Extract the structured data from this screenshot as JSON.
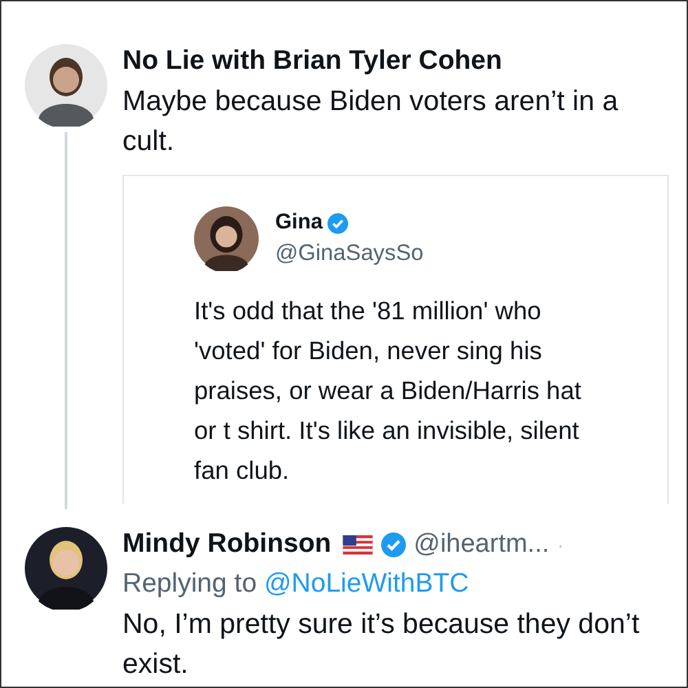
{
  "posts": [
    {
      "author": "No Lie with Brian Tyler Cohen",
      "text": "Maybe because Biden voters aren’t in a cult.",
      "thread": true,
      "quote": {
        "author": "Gina",
        "verified": true,
        "handle": "@GinaSaysSo",
        "text": "It's odd that the '81 million' who 'voted' for Biden, never sing his praises, or wear a Biden/Harris hat or t shirt. It's like an invisible, silent fan club."
      }
    },
    {
      "author": "Mindy Robinson",
      "flag": true,
      "verified": true,
      "handle": "@iheartm...",
      "separator": "·",
      "replying_to": {
        "label": "Replying to",
        "handle": "@NoLieWithBTC"
      },
      "text": "No, I’m pretty sure it’s because they don’t exist."
    }
  ]
}
